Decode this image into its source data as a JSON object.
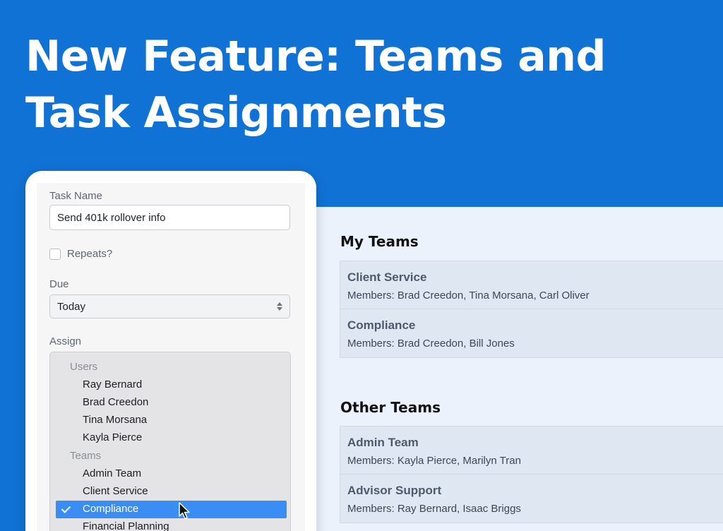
{
  "headline": {
    "line1": "New Feature: Teams and",
    "line2": "Task Assignments"
  },
  "task_form": {
    "task_name_label": "Task Name",
    "task_name_value": "Send 401k rollover info",
    "repeats_label": "Repeats?",
    "repeats_checked": false,
    "due_label": "Due",
    "due_value": "Today",
    "assign_label": "Assign",
    "assign_list": {
      "users_group": "Users",
      "users": [
        "Ray Bernard",
        "Brad Creedon",
        "Tina Morsana",
        "Kayla Pierce"
      ],
      "teams_group": "Teams",
      "teams": [
        "Admin Team",
        "Client Service",
        "Compliance",
        "Financial Planning"
      ],
      "selected": "Compliance"
    }
  },
  "teams_panel": {
    "my_teams_title": "My Teams",
    "my_teams": [
      {
        "name": "Client Service",
        "members": "Members: Brad Creedon, Tina Morsana, Carl Oliver"
      },
      {
        "name": "Compliance",
        "members": "Members: Brad Creedon, Bill Jones"
      }
    ],
    "other_teams_title": "Other Teams",
    "other_teams": [
      {
        "name": "Admin Team",
        "members": "Members: Kayla Pierce, Marilyn Tran"
      },
      {
        "name": "Advisor Support",
        "members": "Members: Ray Bernard, Isaac Briggs"
      }
    ]
  },
  "colors": {
    "background": "#1172d6",
    "selection": "#3a8ef3",
    "panel": "#ebf2fb"
  }
}
